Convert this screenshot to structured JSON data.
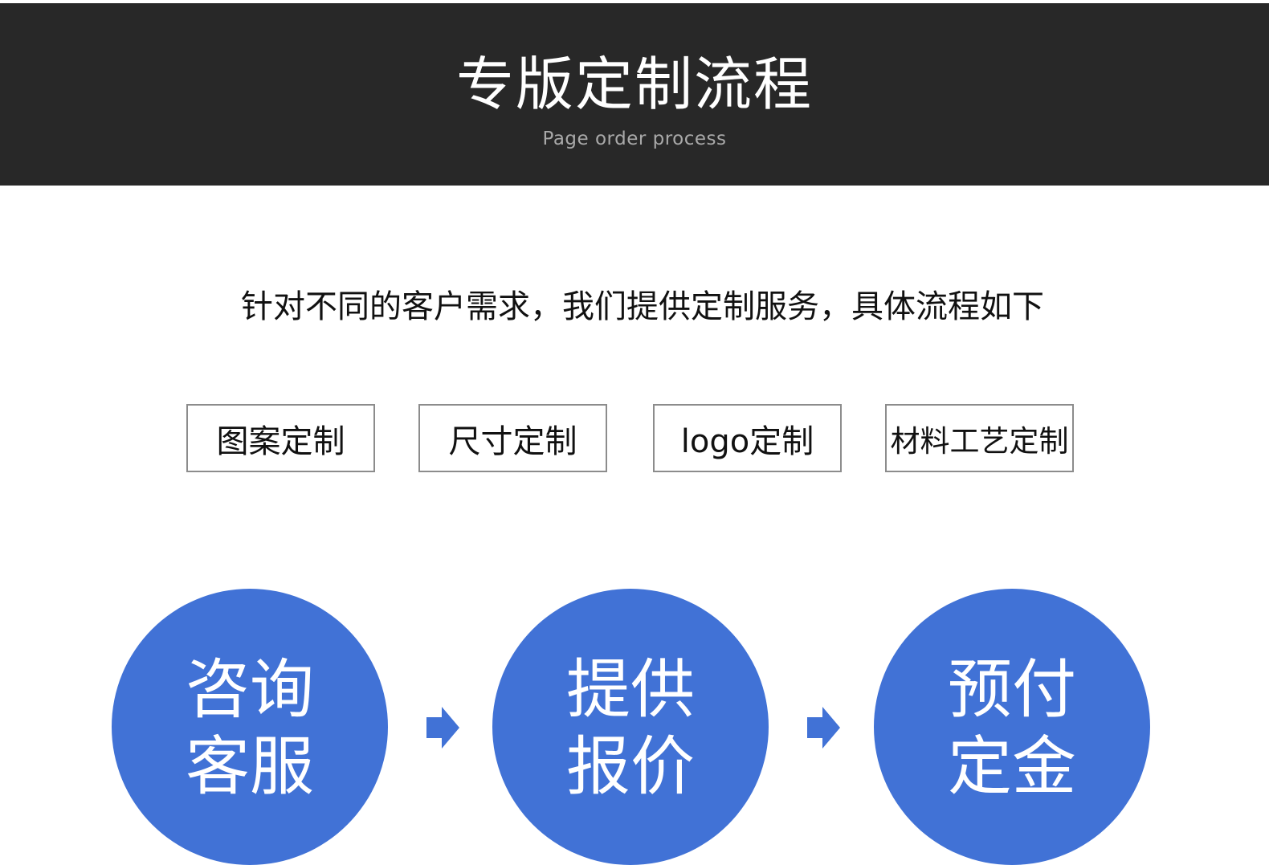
{
  "header": {
    "title": "专版定制流程",
    "subtitle": "Page order process"
  },
  "intro": "针对不同的客户需求，我们提供定制服务，具体流程如下",
  "tags": [
    "图案定制",
    "尺寸定制",
    "logo定制",
    "材料工艺定制"
  ],
  "steps": [
    {
      "label": "咨询\n客服"
    },
    {
      "label": "提供\n报价"
    },
    {
      "label": "预付\n定金"
    }
  ],
  "icons": {
    "arrow": "arrow-right-icon"
  },
  "colors": {
    "header_bg": "#282828",
    "step_blue": "#4172d6",
    "tag_border": "#8c8c8c"
  }
}
